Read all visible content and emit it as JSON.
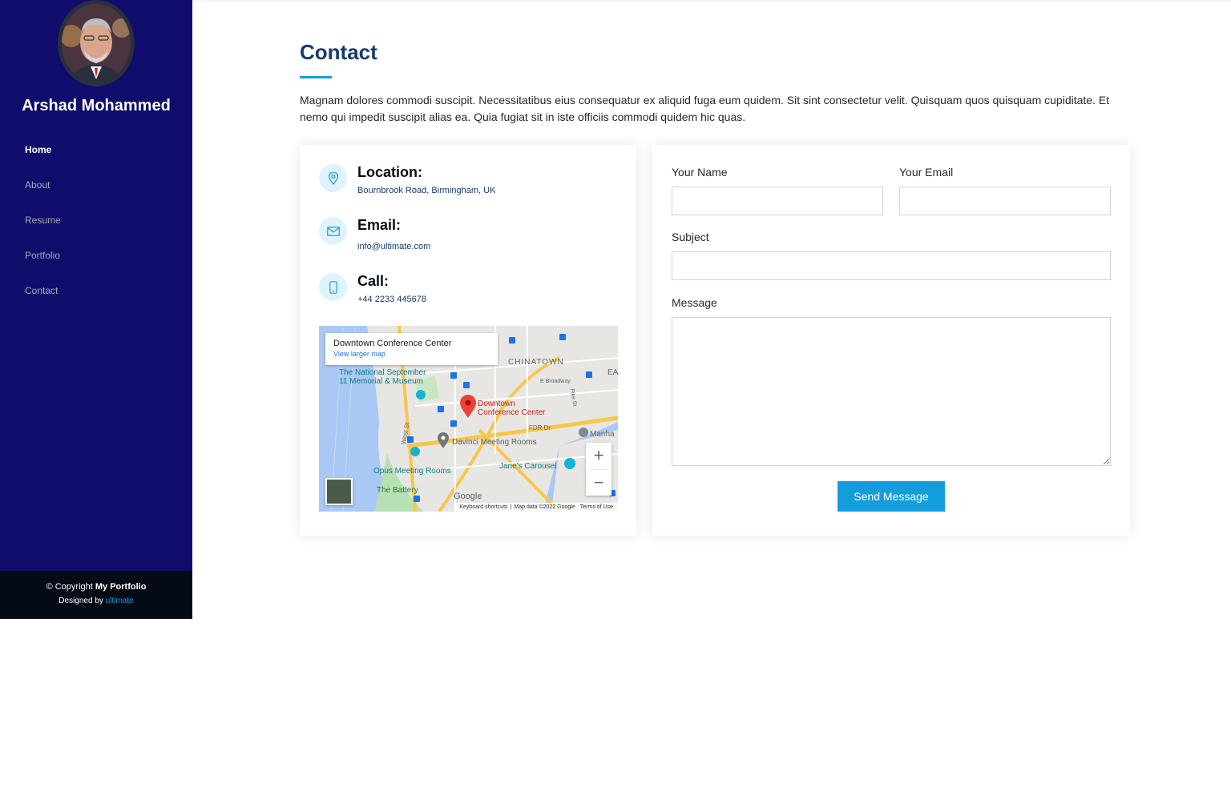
{
  "sidebar": {
    "profile_name": "Arshad Mohammed",
    "nav_items": [
      {
        "label": "Home",
        "active": true
      },
      {
        "label": "About",
        "active": false
      },
      {
        "label": "Resume",
        "active": false
      },
      {
        "label": "Portfolio",
        "active": false
      },
      {
        "label": "Contact",
        "active": false
      }
    ],
    "footer": {
      "copyright_prefix": "© Copyright ",
      "copyright_name": "My Portfolio",
      "designed_by": "Designed by ",
      "designer": "ultimate"
    }
  },
  "main": {
    "title": "Contact",
    "description": "Magnam dolores commodi suscipit. Necessitatibus eius consequatur ex aliquid fuga eum quidem. Sit sint consectetur velit. Quisquam quos quisquam cupiditate. Et nemo qui impedit suscipit alias ea. Quia fugiat sit in iste officiis commodi quidem hic quas.",
    "info": {
      "location_label": "Location:",
      "location_value": "Bournbrook Road, Birmingham, UK",
      "email_label": "Email:",
      "email_value": "info@ultimate.com",
      "call_label": "Call:",
      "call_value": "+44 2233 445678"
    },
    "map": {
      "popup_title": "Downtown Conference Center",
      "popup_link": "View larger map",
      "labels": {
        "chinatown": "CHINATOWN",
        "memorial_1": "The National September",
        "memorial_2": "11 Memorial & Museum",
        "pin_1": "Downtown",
        "pin_2": "Conference Center",
        "davinci": "Davinci Meeting Rooms",
        "opus": "Opus Meeting Rooms",
        "carousel": "Jane's Carousel",
        "battery": "The Battery",
        "broadway": "E Broadway",
        "fdr": "FDR Dr",
        "west_st": "West St",
        "pike": "Pike St",
        "manha": "Manha",
        "ea": "EA"
      },
      "zoom_in": "+",
      "zoom_out": "−",
      "google": "Google",
      "attrib_shortcuts": "Keyboard shortcuts",
      "attrib_data": "Map data ©2022 Google",
      "attrib_terms": "Terms of Use",
      "accent_pin": "#ea4335"
    },
    "form": {
      "name_label": "Your Name",
      "name_value": "",
      "email_label": "Your Email",
      "email_value": "",
      "subject_label": "Subject",
      "subject_value": "",
      "message_label": "Message",
      "message_value": "",
      "submit_label": "Send Message"
    }
  },
  "colors": {
    "sidebar_bg": "#0f0c6b",
    "footer_bg": "#040b14",
    "accent": "#149ddd",
    "title": "#173b6c"
  }
}
